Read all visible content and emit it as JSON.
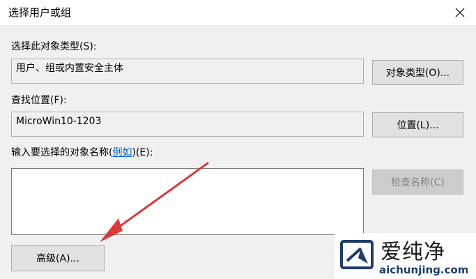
{
  "window": {
    "title": "选择用户或组"
  },
  "object_type": {
    "label": "选择此对象类型(S):",
    "value": "用户、组或内置安全主体",
    "button": "对象类型(O)..."
  },
  "location": {
    "label": "查找位置(F):",
    "value": "MicroWin10-1203",
    "button": "位置(L)..."
  },
  "names": {
    "label_prefix": "输入要选择的对象名称(",
    "label_link": "例如",
    "label_suffix": ")(E):",
    "value": "",
    "check_button": "检查名称(C)"
  },
  "advanced_button": "高级(A)...",
  "watermark": {
    "title": "爱纯净",
    "url": "aichunjing.com"
  },
  "colors": {
    "arrow": "#d63c3c",
    "link": "#0066cc",
    "brand": "#1a3d6b"
  }
}
